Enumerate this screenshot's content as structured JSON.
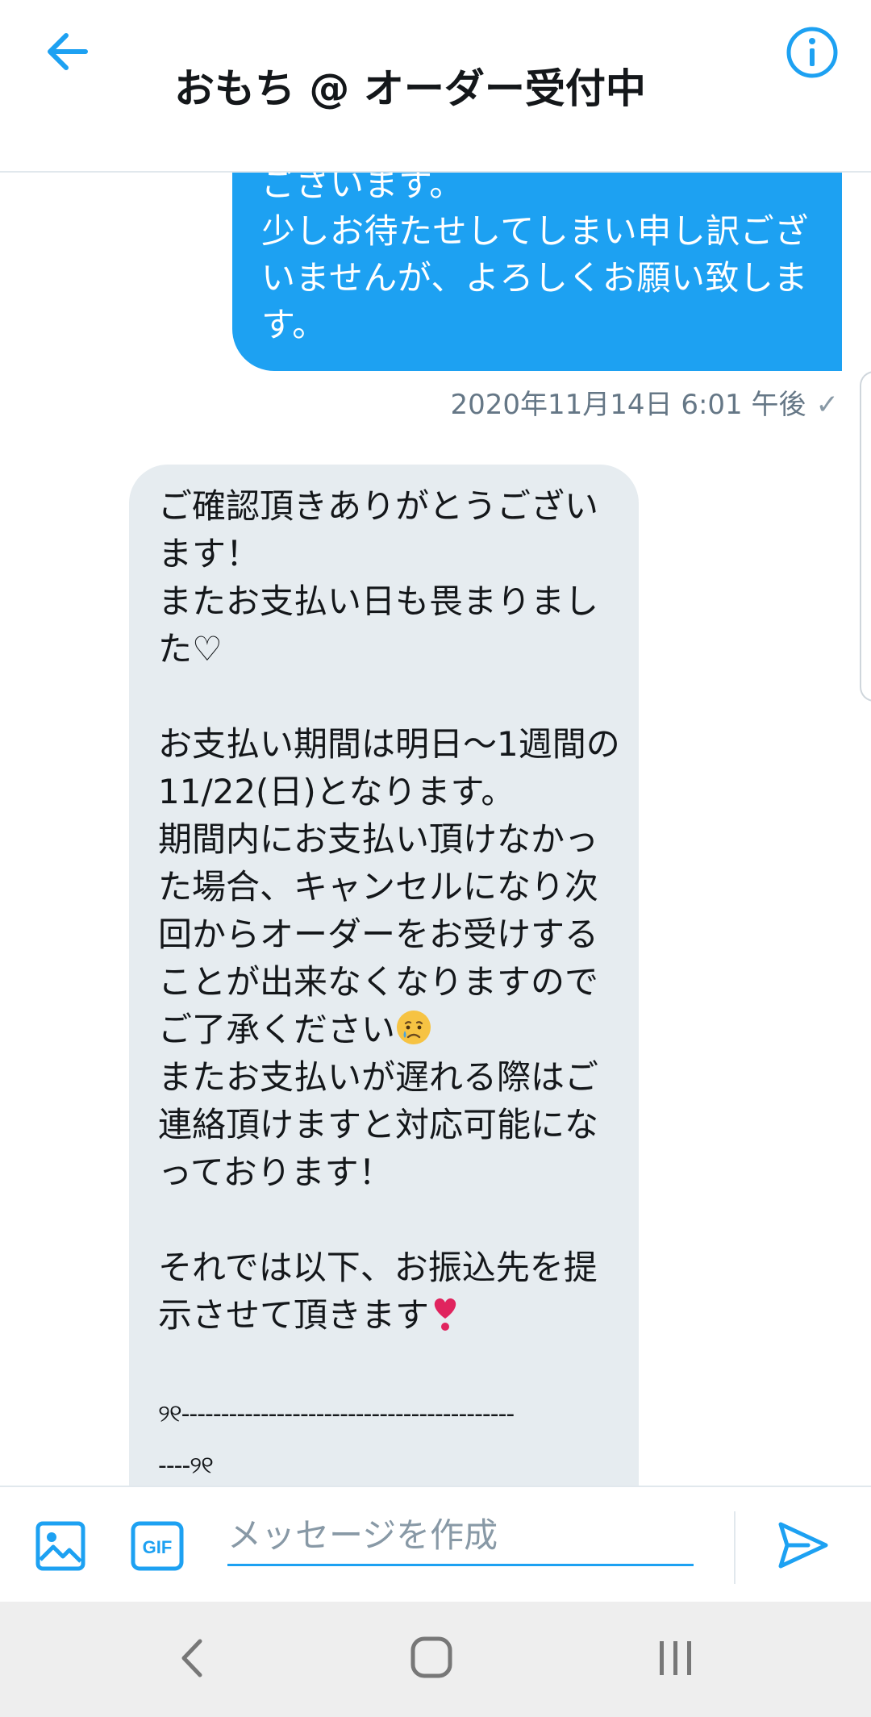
{
  "header": {
    "title": "おもち @ オーダー受付中",
    "back_icon": "arrow-left-icon",
    "info_icon": "info-icon"
  },
  "colors": {
    "accent": "#1da1f2",
    "received_bubble": "#e6ecf0",
    "text": "#14171a",
    "muted": "#657786"
  },
  "messages": {
    "sent": {
      "text": "ございます。\n少しお待たせしてしまい申し訳ございませんが、よろしくお願い致します。",
      "timestamp": "2020年11月14日 6:01 午後",
      "status": "✓"
    },
    "received": {
      "p1": "ご確認頂きありがとうございます！\nまたお支払い日も畏まりました♡",
      "p2a": "お支払い期間は明日〜1週間の11/22(日)となります。\n期間内にお支払い頂けなかった場合、キャンセルになり次回からオーダーをお受けすることが出来なくなりますのでご了承ください",
      "p2b": "またお支払いが遅れる際はご連絡頂けますと対応可能になっております！",
      "p3": "それでは以下、お振込先を提示させて頂きます",
      "dash1": "୨୧------------------------------------------",
      "dash2": "----୨୧"
    }
  },
  "composer": {
    "placeholder": "メッセージを作成",
    "image_icon": "image-icon",
    "gif_label": "GIF",
    "send_icon": "send-icon"
  },
  "navbar": {
    "back_icon": "nav-back-icon",
    "home_icon": "nav-home-icon",
    "recents_icon": "nav-recents-icon"
  }
}
